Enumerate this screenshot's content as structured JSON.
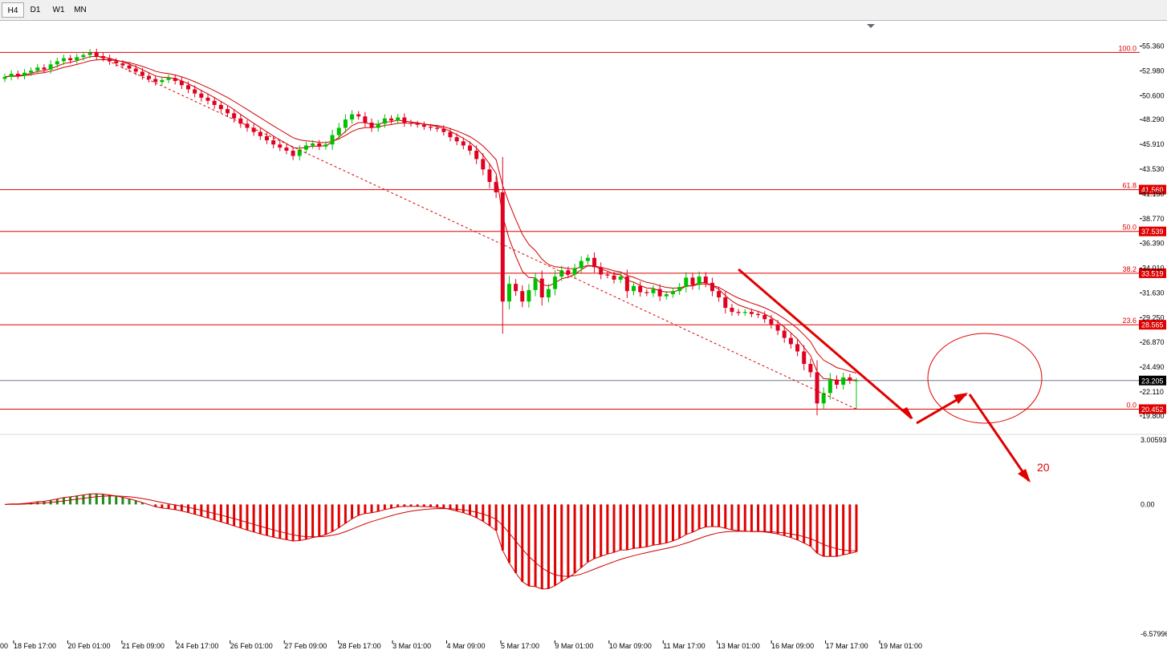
{
  "toolbar": {
    "timeframes": [
      "H4",
      "D1",
      "W1",
      "MN"
    ],
    "active": "H4"
  },
  "colors": {
    "bull": "#00c000",
    "bear": "#e00020",
    "fib": "#e00000",
    "ma": "#d00000",
    "macd_pos": "#1a8c1a",
    "macd_neg": "#e00000",
    "current_line": "#6e7f8a"
  },
  "chart_data": {
    "type": "candlestick",
    "y_axis": {
      "range": [
        18.1,
        56.4
      ],
      "ticks": [
        "55.360",
        "52.980",
        "50.600",
        "48.290",
        "45.910",
        "43.530",
        "41.150",
        "38.770",
        "36.390",
        "34.010",
        "31.630",
        "29.250",
        "26.870",
        "24.490",
        "22.110",
        "19.800"
      ]
    },
    "current_price": "23.205",
    "x_axis": {
      "labels": [
        "18 Feb 17:00",
        "20 Feb 01:00",
        "21 Feb 09:00",
        "24 Feb 17:00",
        "26 Feb 01:00",
        "27 Feb 09:00",
        "28 Feb 17:00",
        "3 Mar 01:00",
        "4 Mar 09:00",
        "5 Mar 17:00",
        "9 Mar 01:00",
        "10 Mar 09:00",
        "11 Mar 17:00",
        "13 Mar 01:00",
        "16 Mar 09:00",
        "17 Mar 17:00",
        "19 Mar 01:00"
      ],
      "edge_label": "00"
    },
    "fibonacci": [
      {
        "level": "100.0",
        "price": 54.75
      },
      {
        "level": "61.8",
        "price": 41.56,
        "tag": "41.560"
      },
      {
        "level": "50.0",
        "price": 37.539,
        "tag": "37.539"
      },
      {
        "level": "38.2",
        "price": 33.519,
        "tag": "33.519"
      },
      {
        "level": "23.6",
        "price": 28.565,
        "tag": "28.565"
      },
      {
        "level": "0.0",
        "price": 20.452,
        "tag": "20.452"
      }
    ],
    "close": [
      52.4,
      52.7,
      52.5,
      52.8,
      53.0,
      53.3,
      53.1,
      53.6,
      53.9,
      54.2,
      54.0,
      54.3,
      54.5,
      54.75,
      54.4,
      54.2,
      53.9,
      53.7,
      53.5,
      53.2,
      52.9,
      52.5,
      52.2,
      51.9,
      52.1,
      52.3,
      52.0,
      51.6,
      51.2,
      50.8,
      50.4,
      50.1,
      49.7,
      49.3,
      48.9,
      48.4,
      47.9,
      47.5,
      47.1,
      46.7,
      46.3,
      45.9,
      45.6,
      45.3,
      44.8,
      45.4,
      45.8,
      46.0,
      45.7,
      45.9,
      46.8,
      47.5,
      48.3,
      48.8,
      48.6,
      48.0,
      47.5,
      47.9,
      48.4,
      48.2,
      48.5,
      48.0,
      47.9,
      47.8,
      47.6,
      47.5,
      47.4,
      47.1,
      46.6,
      46.2,
      45.8,
      45.3,
      44.5,
      43.5,
      42.3,
      41.3,
      30.8,
      32.5,
      31.8,
      30.8,
      31.9,
      33.0,
      31.2,
      32.0,
      33.2,
      33.8,
      33.4,
      34.0,
      34.7,
      35.0,
      34.1,
      33.4,
      33.3,
      32.9,
      33.2,
      31.8,
      32.3,
      31.7,
      31.6,
      32.0,
      31.3,
      31.5,
      31.8,
      32.2,
      33.1,
      32.4,
      33.2,
      32.6,
      31.8,
      31.2,
      30.2,
      29.8,
      29.7,
      29.8,
      29.6,
      29.5,
      29.1,
      28.6,
      28.0,
      27.3,
      26.7,
      26.0,
      24.8,
      24.0,
      21.0,
      22.0,
      23.3,
      22.8,
      23.5,
      23.2,
      23.205
    ],
    "indicators": {
      "moving_averages": [
        "fast",
        "slow"
      ],
      "macd_histogram_axis": [
        "3.00593",
        "0.00",
        "-6.57996"
      ]
    },
    "annotations": {
      "projection_label": "20"
    }
  }
}
